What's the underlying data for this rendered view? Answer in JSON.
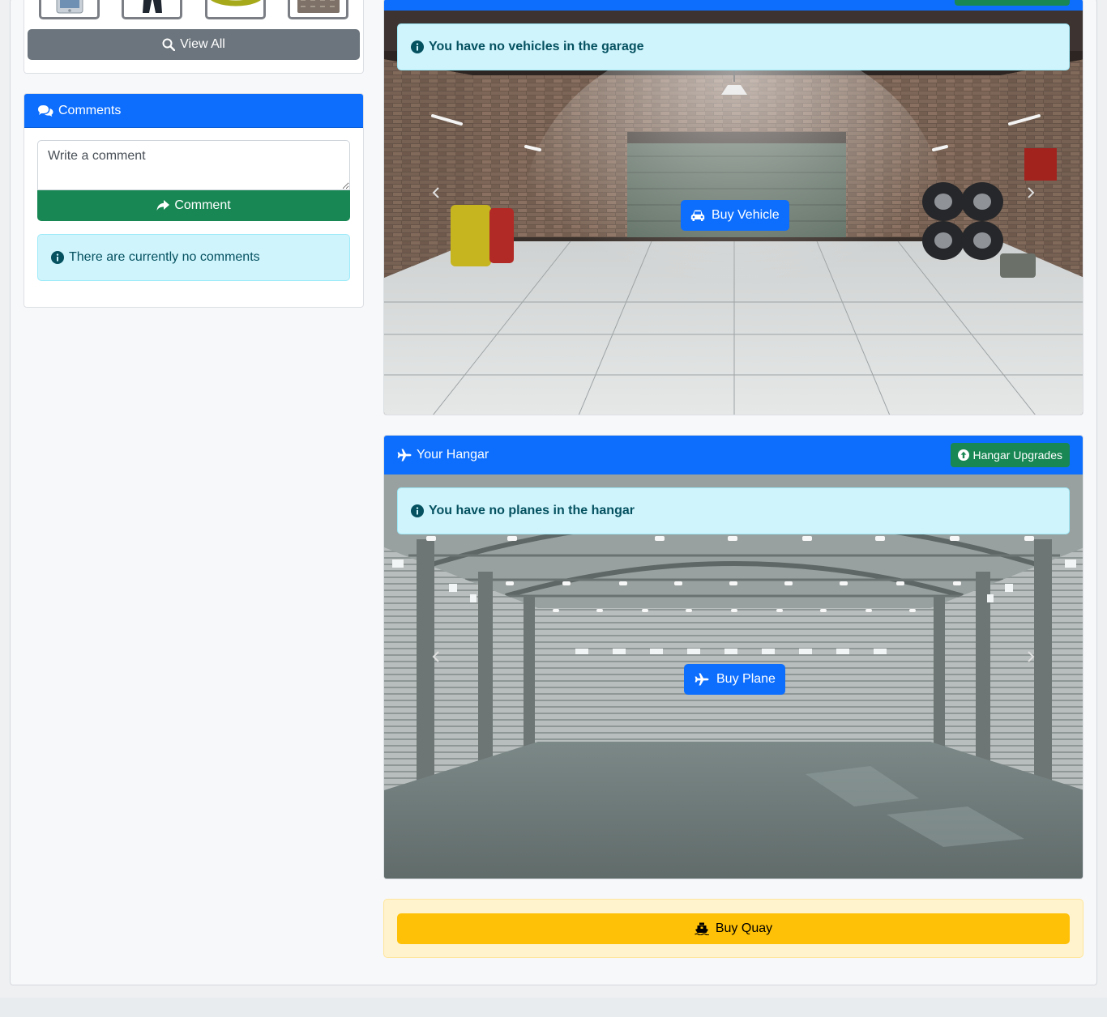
{
  "sidebar": {
    "thumbnails": [
      {
        "icon": "tablet-icon"
      },
      {
        "icon": "trousers-icon"
      },
      {
        "icon": "ring-icon"
      },
      {
        "icon": "bag-icon"
      }
    ],
    "view_all_label": "View All",
    "comments": {
      "title": "Comments",
      "placeholder": "Write a comment",
      "submit_label": "Comment",
      "empty_message": "There are currently no comments"
    }
  },
  "garage": {
    "empty_message": "You have no vehicles in the garage",
    "buy_label": "Buy Vehicle"
  },
  "hangar": {
    "title": "Your Hangar",
    "upgrades_label": "Hangar Upgrades",
    "empty_message": "You have no planes in the hangar",
    "buy_label": "Buy Plane"
  },
  "quay": {
    "buy_label": "Buy Quay"
  },
  "colors": {
    "primary": "#0d6efd",
    "success": "#198754",
    "secondary": "#6c757d",
    "info_bg": "#cff4fc",
    "info_text": "#055160",
    "warning": "#ffc107",
    "warning_bg": "#fff3cd"
  }
}
